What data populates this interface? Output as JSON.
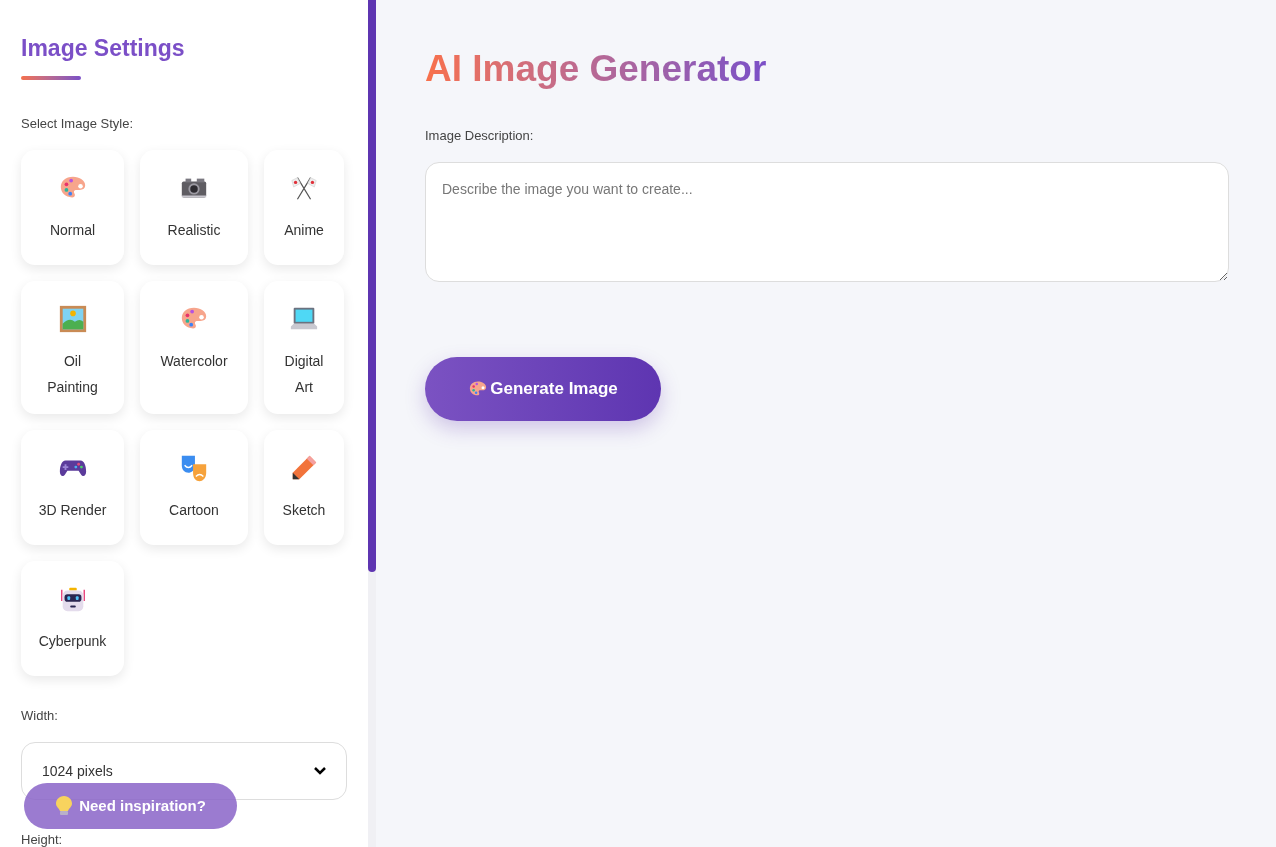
{
  "sidebar": {
    "title": "Image Settings",
    "style_label": "Select Image Style:",
    "styles": [
      {
        "label": "Normal"
      },
      {
        "label": "Realistic"
      },
      {
        "label": "Anime"
      },
      {
        "label": "Oil Painting"
      },
      {
        "label": "Watercolor"
      },
      {
        "label": "Digital Art"
      },
      {
        "label": "3D Render"
      },
      {
        "label": "Cartoon"
      },
      {
        "label": "Sketch"
      },
      {
        "label": "Cyberpunk"
      }
    ],
    "width": {
      "label": "Width:",
      "value": "1024 pixels"
    },
    "height": {
      "label": "Height:"
    }
  },
  "main": {
    "title": "AI Image Generator",
    "description_label": "Image Description:",
    "description": {
      "placeholder": "Describe the image you want to create..."
    },
    "generate_button": "Generate Image"
  },
  "inspiration_button": "Need inspiration?"
}
